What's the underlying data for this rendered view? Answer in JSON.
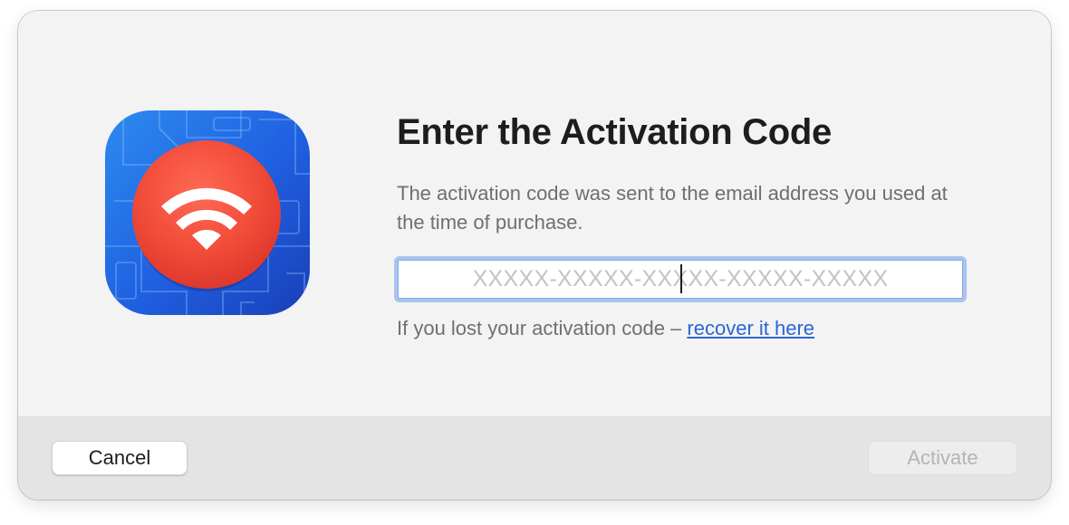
{
  "dialog": {
    "title": "Enter the Activation Code",
    "subtitle": "The activation code was sent to the email address you used at the time of purchase.",
    "code_input": {
      "placeholder": "XXXXX-XXXXX-XXXXX-XXXXX-XXXXX",
      "value": "",
      "focused": true
    },
    "lost_code_text": "If you lost your activation code – ",
    "recover_link_label": "recover it here",
    "app_icon": {
      "icon": "wifi-app-icon",
      "badge_color": "#ee4a3b",
      "background_color": "#1f5fe0"
    }
  },
  "buttons": {
    "cancel_label": "Cancel",
    "activate_label": "Activate",
    "activate_enabled": false
  },
  "colors": {
    "accent": "#2a66d2",
    "focus_ring": "#a9c3f2"
  }
}
